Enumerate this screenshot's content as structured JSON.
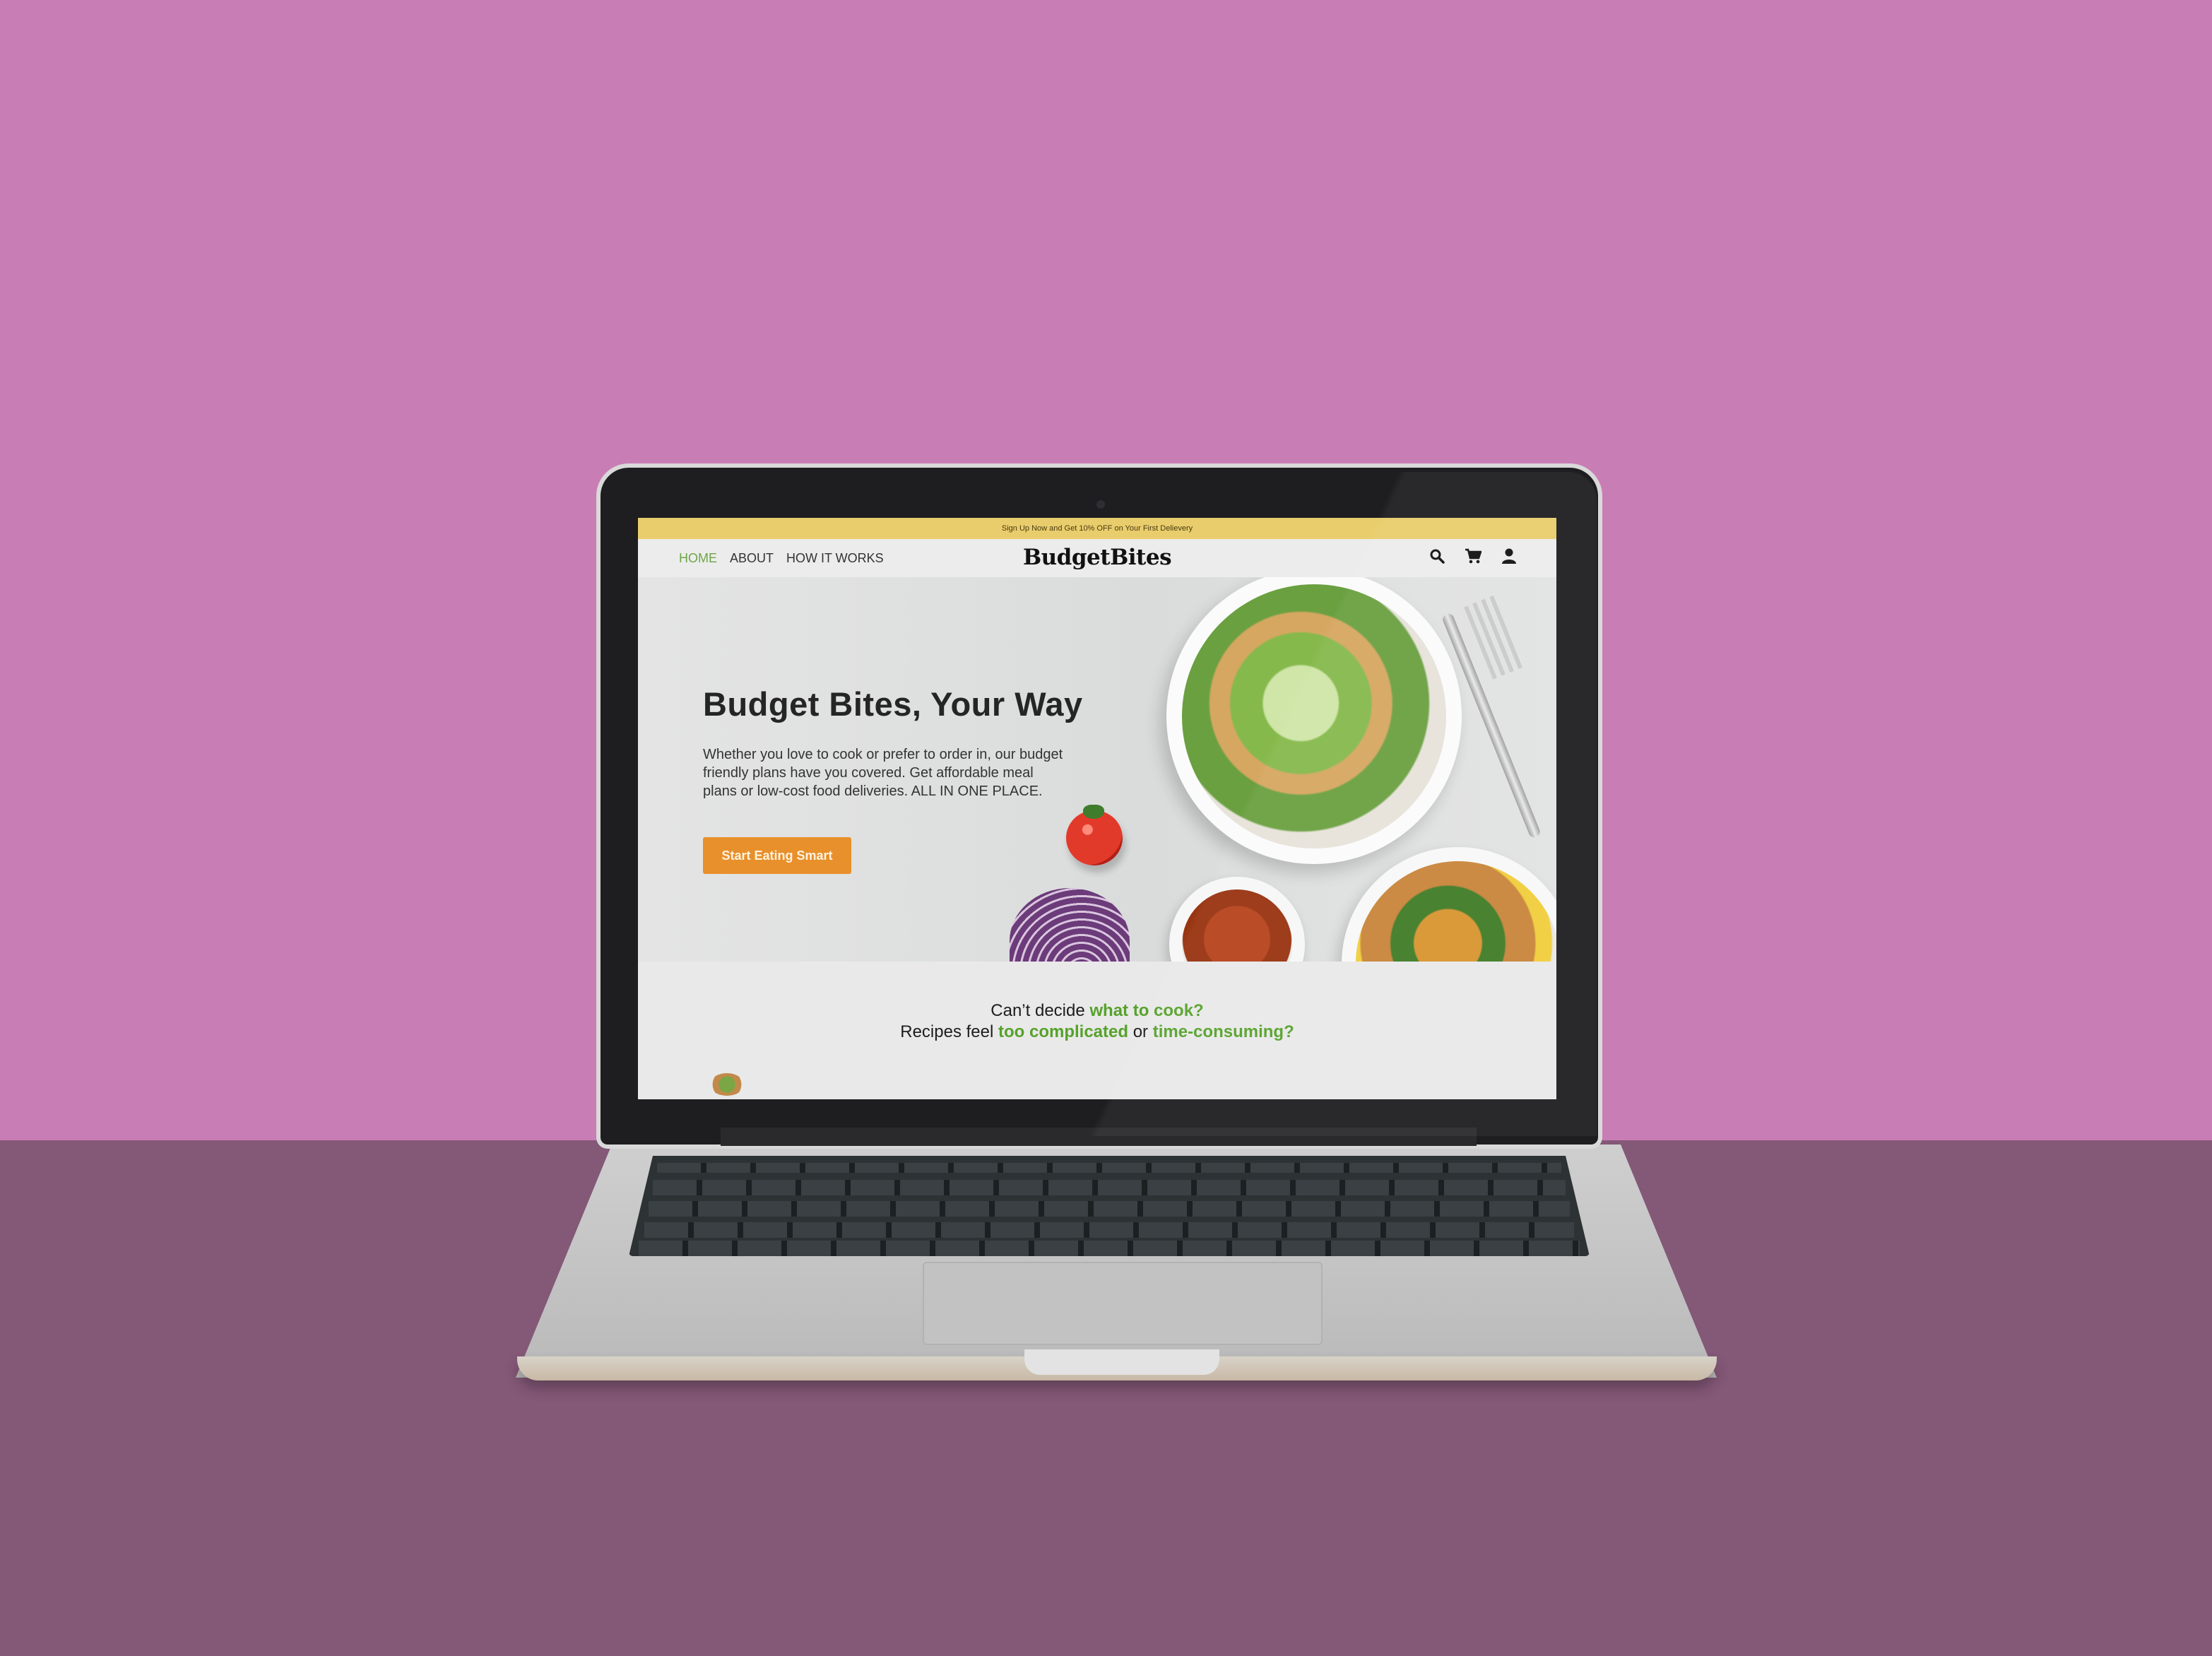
{
  "promo_bar": {
    "text": "Sign Up Now and Get 10% OFF on Your First Delievery"
  },
  "nav": {
    "links": [
      {
        "label": "HOME",
        "active": true
      },
      {
        "label": "ABOUT",
        "active": false
      },
      {
        "label": "HOW IT WORKS",
        "active": false
      }
    ],
    "logo": "BudgetBites",
    "icons": [
      "search-icon",
      "cart-icon",
      "account-icon"
    ]
  },
  "hero": {
    "title": "Budget Bites, Your Way",
    "description": "Whether you love to cook or prefer to order in, our budget friendly plans have you covered. Get affordable meal plans or low-cost food deliveries. ALL IN ONE PLACE.",
    "cta_label": "Start Eating Smart"
  },
  "section2": {
    "line1_prefix": "Can’t decide ",
    "line1_highlight": "what to cook?",
    "line2_prefix": "Recipes feel ",
    "line2_highlight1": "too complicated",
    "line2_middle": " or ",
    "line2_highlight2": "time-consuming?"
  },
  "colors": {
    "accent_green": "#56a22b",
    "cta_orange": "#e8902b",
    "promo_yellow": "#e9cd6c",
    "background_wall": "#c97db5",
    "background_desk": "#845877"
  }
}
